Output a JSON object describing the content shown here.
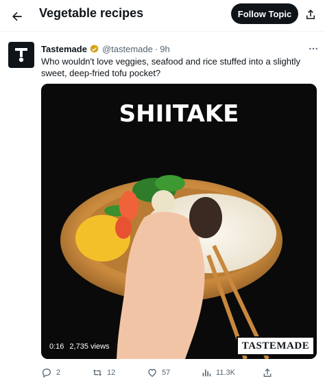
{
  "header": {
    "title": "Vegetable recipes",
    "follow_label": "Follow Topic"
  },
  "tweet": {
    "display_name": "Tastemade",
    "handle": "@tastemade",
    "separator": "·",
    "time": "9h",
    "text": "Who wouldn't love veggies, seafood and rice stuffed into a slightly sweet, deep-fried tofu pocket?",
    "media": {
      "overlay_title": "SHIITAKE",
      "duration": "0:16",
      "views": "2,735 views",
      "brand": "TASTEMADE"
    },
    "actions": {
      "replies": "2",
      "retweets": "12",
      "likes": "57",
      "views": "11.3K"
    }
  },
  "colors": {
    "text_primary": "#0f1419",
    "text_secondary": "#536471",
    "verified_badge": "#d4a017"
  }
}
